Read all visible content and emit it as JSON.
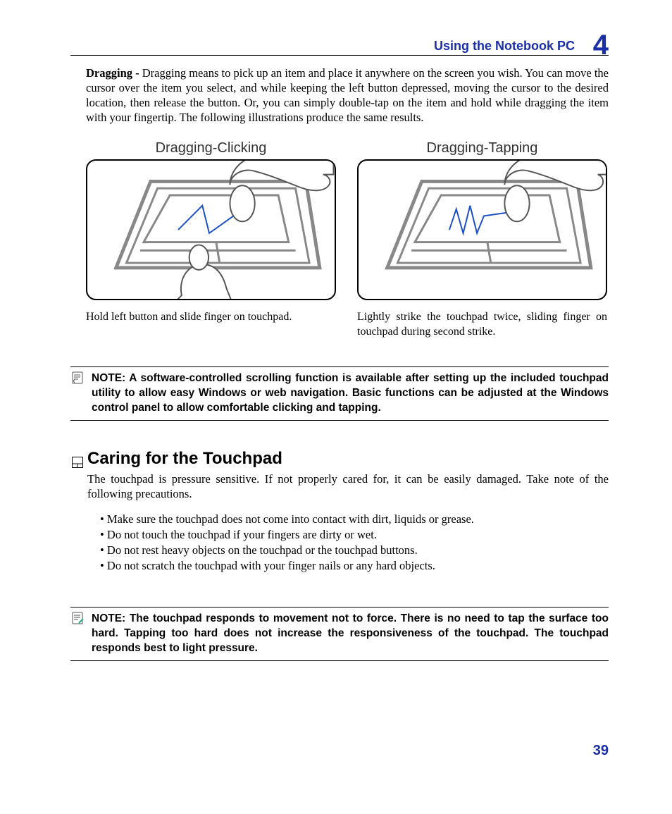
{
  "header": {
    "title": "Using the Notebook PC",
    "chapter_number": "4"
  },
  "dragging": {
    "term": "Dragging - ",
    "text": "Dragging means to pick up an item and place it anywhere on the screen you wish. You can move the cursor over the item you select, and while keeping the left button depressed, moving the cursor to the desired location, then release the button. Or, you can simply double-tap on the item and hold while dragging the item with your fingertip. The following illustrations produce the same results."
  },
  "figures": {
    "left": {
      "label": "Dragging-Clicking",
      "caption": "Hold left button and slide finger on touchpad."
    },
    "right": {
      "label": "Dragging-Tapping",
      "caption": "Lightly strike the touchpad twice, sliding finger on touchpad during second strike."
    }
  },
  "note1": {
    "prefix": "NOTE: ",
    "text": "A software-controlled scrolling function is available after setting up the included touchpad utility to allow easy Windows or web navigation. Basic functions can be adjusted at the Windows control panel to allow comfortable clicking and tapping."
  },
  "section": {
    "heading": "Caring for the Touchpad",
    "intro": "The touchpad is pressure sensitive. If not properly cared for, it can be easily damaged. Take note of the following precautions.",
    "items": [
      "Make sure the touchpad does not come into contact with dirt, liquids or grease.",
      "Do not touch the touchpad if your fingers are dirty or wet.",
      "Do not rest heavy objects on the touchpad or the touchpad buttons.",
      "Do not scratch the touchpad with your finger nails or any hard objects."
    ]
  },
  "note2": {
    "prefix": "NOTE:  ",
    "text": "The touchpad responds to movement not to force. There is no need to tap the surface too hard. Tapping too hard does not increase the responsiveness of the touchpad. The touchpad responds best to light pressure."
  },
  "page_number": "39"
}
